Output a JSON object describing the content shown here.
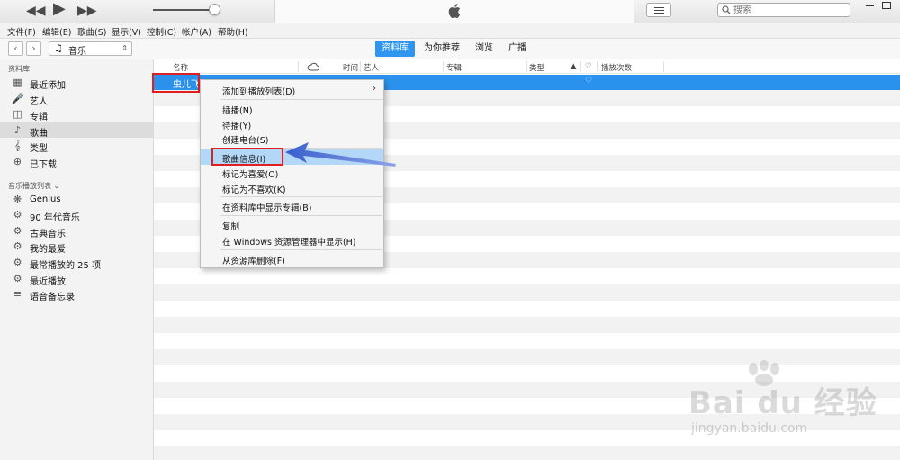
{
  "search": {
    "placeholder": "搜索"
  },
  "menubar": [
    "文件(F)",
    "编辑(E)",
    "歌曲(S)",
    "显示(V)",
    "控制(C)",
    "帐户(A)",
    "帮助(H)"
  ],
  "nav": {
    "source_label": "音乐",
    "tabs": [
      "资料库",
      "为你推荐",
      "浏览",
      "广播"
    ],
    "active_tab": "资料库"
  },
  "sidebar": {
    "library_heading": "资料库",
    "library_items": [
      {
        "label": "最近添加",
        "icon": "recently-added-icon"
      },
      {
        "label": "艺人",
        "icon": "microphone-icon"
      },
      {
        "label": "专辑",
        "icon": "album-icon"
      },
      {
        "label": "歌曲",
        "icon": "note-icon"
      },
      {
        "label": "类型",
        "icon": "genre-icon"
      },
      {
        "label": "已下载",
        "icon": "download-icon"
      }
    ],
    "playlist_heading": "音乐播放列表 ⌄",
    "playlist_items": [
      {
        "label": "Genius",
        "icon": "genius-icon"
      },
      {
        "label": "90 年代音乐",
        "icon": "gear-icon"
      },
      {
        "label": "古典音乐",
        "icon": "gear-icon"
      },
      {
        "label": "我的最爱",
        "icon": "gear-icon"
      },
      {
        "label": "最常播放的 25 项",
        "icon": "gear-icon"
      },
      {
        "label": "最近播放",
        "icon": "gear-icon"
      },
      {
        "label": "语音备忘录",
        "icon": "voice-memo-icon"
      }
    ]
  },
  "columns": [
    "名称",
    "时间",
    "艺人",
    "专辑",
    "类型",
    "播放次数"
  ],
  "song": {
    "name": "虫儿飞"
  },
  "context_menu": [
    {
      "label": "添加到播放列表(D)",
      "submenu": true
    },
    {
      "label": "插播(N)"
    },
    {
      "label": "待播(Y)"
    },
    {
      "label": "创建电台(S)"
    },
    {
      "label": "歌曲信息(I)",
      "highlighted": true
    },
    {
      "label": "标记为喜爱(O)"
    },
    {
      "label": "标记为不喜欢(K)"
    },
    {
      "label": "在资料库中显示专辑(B)"
    },
    {
      "label": "复制"
    },
    {
      "label": "在 Windows 资源管理器中显示(H)"
    },
    {
      "label": "从资源库删除(F)"
    }
  ],
  "watermark": {
    "logo": "Bai du 经验",
    "url": "jingyan.baidu.com"
  },
  "colors": {
    "accent": "#2f95ee",
    "highlight": "#b3d7f7",
    "annotation": "#e02020",
    "arrow": "#3a5fcd"
  }
}
